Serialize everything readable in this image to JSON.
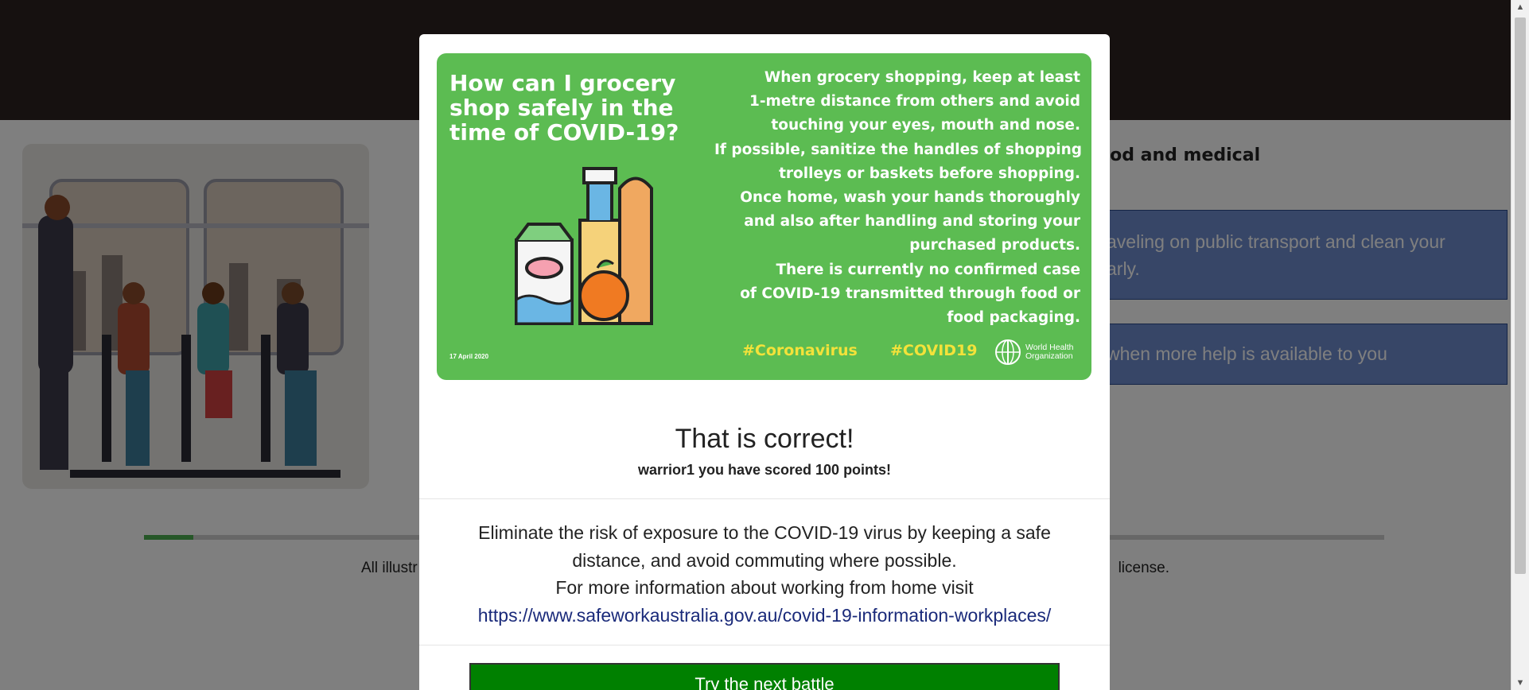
{
  "background": {
    "question_heading": "ood and medical",
    "options": [
      {
        "text": "aveling on public transport and clean your\narly."
      },
      {
        "text": "when more help is available to you"
      }
    ],
    "credit_left": "All illustr",
    "credit_right": "license.",
    "progress_fraction": 0.04
  },
  "modal": {
    "poster": {
      "title": "How can I grocery shop safely in the time of COVID-19?",
      "lines": [
        "When grocery shopping, keep at least",
        "1-metre distance from others and avoid",
        "touching your eyes, mouth and nose.",
        "If possible, sanitize the handles of shopping",
        "trolleys or baskets before shopping.",
        "Once home, wash your hands thoroughly",
        "and also after handling and storing your",
        "purchased products.",
        "There is currently no confirmed case",
        "of COVID-19 transmitted through food or",
        "food packaging."
      ],
      "date": "17 April 2020",
      "hashtag1": "#Coronavirus",
      "hashtag2": "#COVID19",
      "org_line1": "World Health",
      "org_line2": "Organization"
    },
    "result_title": "That is correct!",
    "result_subtitle": "warrior1 you have scored 100 points!",
    "info_line1": "Eliminate the risk of exposure to the COVID-19 virus by keeping a safe",
    "info_line2": "distance, and avoid commuting where possible.",
    "info_line3": "For more information about working from home visit",
    "info_link": "https://www.safeworkaustralia.gov.au/covid-19-information-workplaces/",
    "next_button": "Try the next battle"
  },
  "colors": {
    "topbar": "#2d2320",
    "poster_green": "#5cbc52",
    "button_green": "#008000",
    "option_blue": "#6e8ccf",
    "hashtag_yellow": "#f3e23a"
  }
}
